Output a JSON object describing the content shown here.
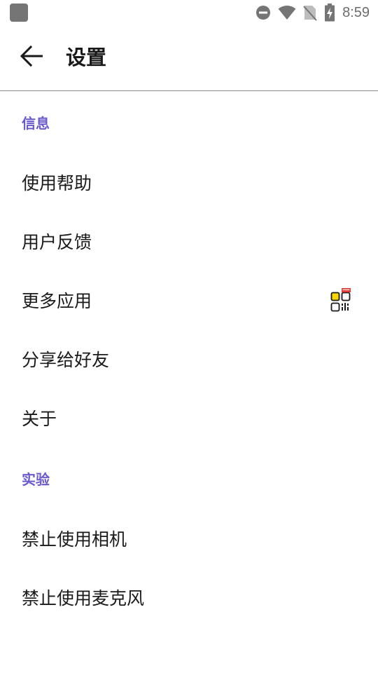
{
  "status_bar": {
    "time": "8:59",
    "icons": [
      "notification-icon",
      "do-not-disturb-icon",
      "wifi-icon",
      "no-sim-icon",
      "battery-charging-icon"
    ]
  },
  "app_bar": {
    "back_icon": "arrow-back-icon",
    "title": "设置"
  },
  "sections": [
    {
      "header": "信息",
      "items": [
        {
          "label": "使用帮助"
        },
        {
          "label": "用户反馈"
        },
        {
          "label": "更多应用",
          "trailing_icon": "app-grid-new-icon"
        },
        {
          "label": "分享给好友"
        },
        {
          "label": "关于"
        }
      ]
    },
    {
      "header": "实验",
      "items": [
        {
          "label": "禁止使用相机"
        },
        {
          "label": "禁止使用麦克风"
        }
      ]
    }
  ],
  "colors": {
    "section_header": "#6a5acd",
    "text_primary": "#1a1a1a",
    "status_icons": "#757575",
    "divider": "#8c8c8c",
    "badge_red": "#e53935",
    "badge_yellow": "#ffd600"
  }
}
